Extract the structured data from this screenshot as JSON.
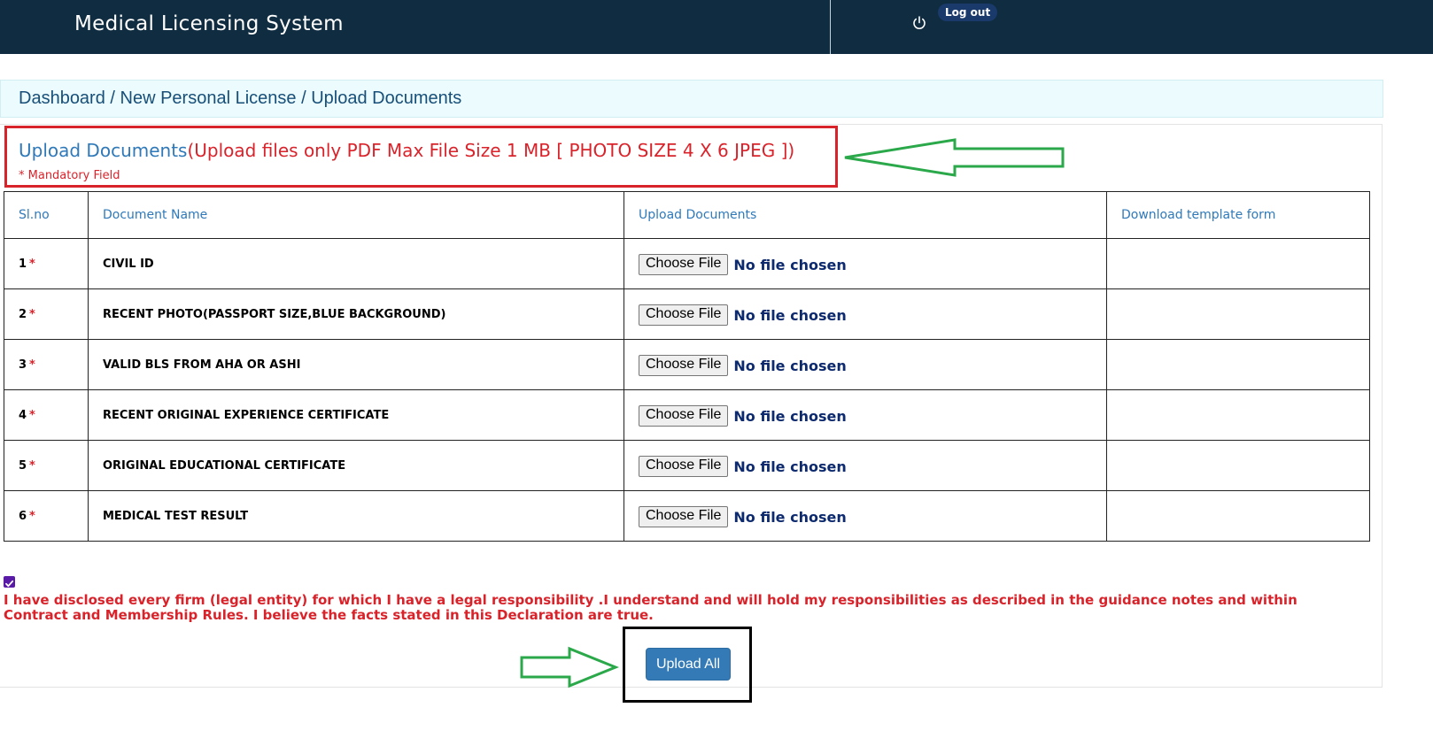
{
  "header": {
    "title": "Medical Licensing System",
    "logout_label": "Log out"
  },
  "breadcrumb": {
    "items": [
      "Dashboard",
      "New Personal License",
      "Upload Documents"
    ],
    "separator": " / "
  },
  "heading": {
    "title": "Upload Documents",
    "note": "(Upload files only PDF Max File Size 1 MB [ PHOTO SIZE 4 X 6 JPEG ])",
    "mandatory": "* Mandatory Field"
  },
  "table": {
    "headers": [
      "Sl.no",
      "Document Name",
      "Upload Documents",
      "Download template form"
    ],
    "required_marker": "*",
    "rows": [
      {
        "no": "1",
        "name": "CIVIL ID",
        "button": "Choose File",
        "status": "No file chosen"
      },
      {
        "no": "2",
        "name": "RECENT PHOTO(PASSPORT SIZE,BLUE BACKGROUND)",
        "button": "Choose File",
        "status": "No file chosen"
      },
      {
        "no": "3",
        "name": "VALID BLS FROM AHA OR ASHI",
        "button": "Choose File",
        "status": "No file chosen"
      },
      {
        "no": "4",
        "name": "RECENT ORIGINAL EXPERIENCE CERTIFICATE",
        "button": "Choose File",
        "status": "No file chosen"
      },
      {
        "no": "5",
        "name": "ORIGINAL EDUCATIONAL CERTIFICATE",
        "button": "Choose File",
        "status": "No file chosen"
      },
      {
        "no": "6",
        "name": "MEDICAL TEST RESULT",
        "button": "Choose File",
        "status": "No file chosen"
      }
    ]
  },
  "declaration": {
    "checked": true,
    "text": "I have disclosed every firm (legal entity) for which I have a legal responsibility .I understand and will hold my responsibilities as described in the guidance notes and within Contract and Membership Rules. I believe the facts stated in this Declaration are true."
  },
  "actions": {
    "upload_all_label": "Upload All"
  },
  "colors": {
    "header_bg": "#102c40",
    "accent_blue": "#2f79b9",
    "mandatory_red": "#d9232b",
    "annotation_green": "#2aa84a",
    "button_blue": "#337ab7"
  }
}
